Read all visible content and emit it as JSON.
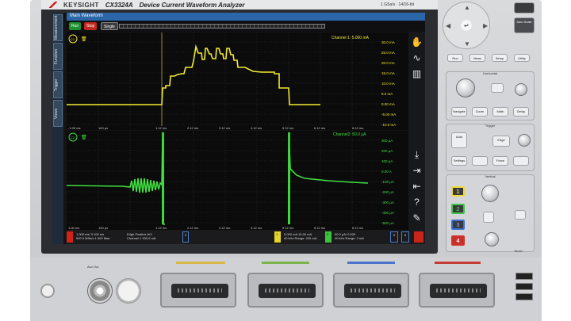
{
  "instrument": {
    "brand": "KEYSIGHT",
    "model": "CX3324A",
    "subtitle": "Device Current Waveform Analyzer",
    "spec": "1 GSa/s · 14/16-bit"
  },
  "screen": {
    "window_title": "Main Waveform",
    "side_tabs": [
      "Measurement",
      "Function",
      "Trigger",
      "Views"
    ],
    "run_controls": {
      "run": "Run",
      "stop": "Stop",
      "single": "Single"
    },
    "ch1": {
      "badge": "C1",
      "label": "Channel 1: 5.000 mA",
      "y_ticks": [
        "30.0 mA",
        "25.0 mA",
        "20.0 mA",
        "15.0 mA",
        "10.0 mA",
        "5.0 mA",
        "0.00 mA",
        "-5.00 mA",
        "-10.0 mA"
      ],
      "x_ticks": [
        "-1.00 ms",
        "100 µs",
        "1.12 ms",
        "2.12 ms",
        "3.12 ms",
        "4.12 ms",
        "5.12 ms",
        "6.12 ms",
        "8.12 ms"
      ]
    },
    "ch2": {
      "badge": "C2",
      "label": "Channel2: 50.0 µA",
      "y_ticks": [
        "300 µA",
        "200 µA",
        "100 µA",
        "0.00 A",
        "-100 µA",
        "-200 µA",
        "-300 µA",
        "-400 µA",
        "-500 µA"
      ],
      "x_ticks": [
        "1.00 ms",
        "100 µs",
        "1.12 ms",
        "2.12 ms",
        "3.12 ms",
        "4.12 ms",
        "5.12 ms",
        "6.12 ms",
        "8.12 ms"
      ]
    },
    "status": {
      "acq_line1": "1.000 ms/  3.100 ms",
      "acq_line2": "500 0 MSa/s  1.000 Msa",
      "trig_line1": "Edge  Positive     AC/",
      "trig_line2": "Channel 1  900.0 mA",
      "trig_num": "0",
      "ch1_line1": "5.000 mA  10.00 mA",
      "ch1_line2": "40 kHz     Range: 200 mA",
      "ch1_num": "1",
      "ch2_line1": "50.0 µA/  0.000",
      "ch2_line2": "40 kHz  Range: 2 mA",
      "ch2_num": "2",
      "btn5": "5",
      "btn6": "6"
    },
    "right_tools": [
      "hand-icon",
      "math-icon",
      "bars-icon",
      "save-icon",
      "export-icon",
      "import-icon",
      "help-icon",
      "ruler-icon"
    ]
  },
  "panel": {
    "keys_top": [
      "Run",
      "Meas",
      "Setup",
      "Utility"
    ],
    "auto_scale": "Auto Scale",
    "horizontal_title": "Horizontal",
    "horizontal_keys": [
      "Zoom",
      "Navigate",
      "Math",
      "Delay"
    ],
    "trigger_title": "Trigger",
    "trigger_keys": [
      "Auto",
      "Edge",
      "Settings",
      "Force"
    ],
    "vertical_title": "Vertical",
    "channel_keys": [
      {
        "label": "1",
        "color": "#f1d93a"
      },
      {
        "label": "2",
        "color": "#44c14a"
      },
      {
        "label": "3",
        "color": "#3b6fd1"
      },
      {
        "label": "4",
        "color": "#d4302a"
      }
    ],
    "touch_label": "Touch"
  },
  "front": {
    "port_label": "Aux Out",
    "led_colors": [
      "#d9b84a",
      "#7ab44a",
      "#4a73c9",
      "#c63a34"
    ]
  },
  "colors": {
    "ch1_trace": "#f2ea2e",
    "ch2_trace": "#3fe03f",
    "grid": "#2f3a34",
    "screen_bg": "#0b0b0c"
  }
}
